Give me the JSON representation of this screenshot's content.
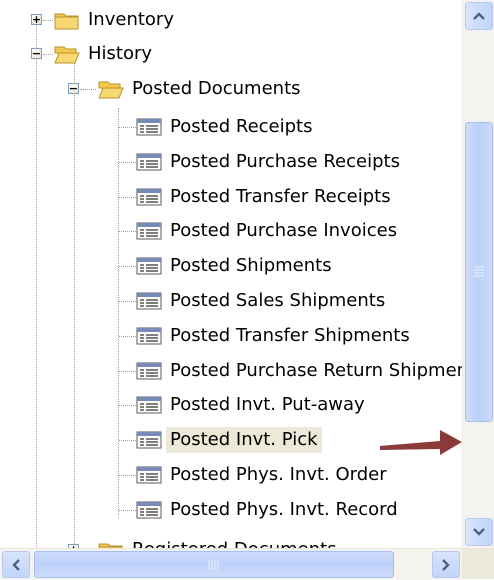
{
  "tree": {
    "inventory": {
      "label": "Inventory",
      "expander": "+"
    },
    "history": {
      "label": "History",
      "expander": "−"
    },
    "posted_documents": {
      "label": "Posted Documents",
      "expander": "−"
    },
    "items": [
      {
        "label": "Posted Receipts",
        "icon": "form-icon"
      },
      {
        "label": "Posted Purchase Receipts",
        "icon": "form-icon"
      },
      {
        "label": "Posted Transfer Receipts",
        "icon": "form-icon"
      },
      {
        "label": "Posted Purchase Invoices",
        "icon": "form-icon"
      },
      {
        "label": "Posted Shipments",
        "icon": "form-icon"
      },
      {
        "label": "Posted Sales Shipments",
        "icon": "form-icon"
      },
      {
        "label": "Posted Transfer Shipments",
        "icon": "form-icon"
      },
      {
        "label": "Posted Purchase Return Shipments",
        "icon": "form-icon"
      },
      {
        "label": "Posted Invt. Put-away",
        "icon": "form-icon"
      },
      {
        "label": "Posted Invt. Pick",
        "icon": "form-icon",
        "selected": true
      },
      {
        "label": "Posted Phys. Invt. Order",
        "icon": "form-icon"
      },
      {
        "label": "Posted Phys. Invt. Record",
        "icon": "form-icon"
      }
    ],
    "registered_documents": {
      "label": "Registered Documents",
      "expander": "+"
    }
  },
  "annotation": {
    "arrow_color": "#8b3a3a",
    "points_to": "Posted Invt. Pick"
  },
  "colors": {
    "selection": "#ece9d8",
    "folder": "#f2c94c",
    "scrollbar": "#c2d4fa"
  }
}
